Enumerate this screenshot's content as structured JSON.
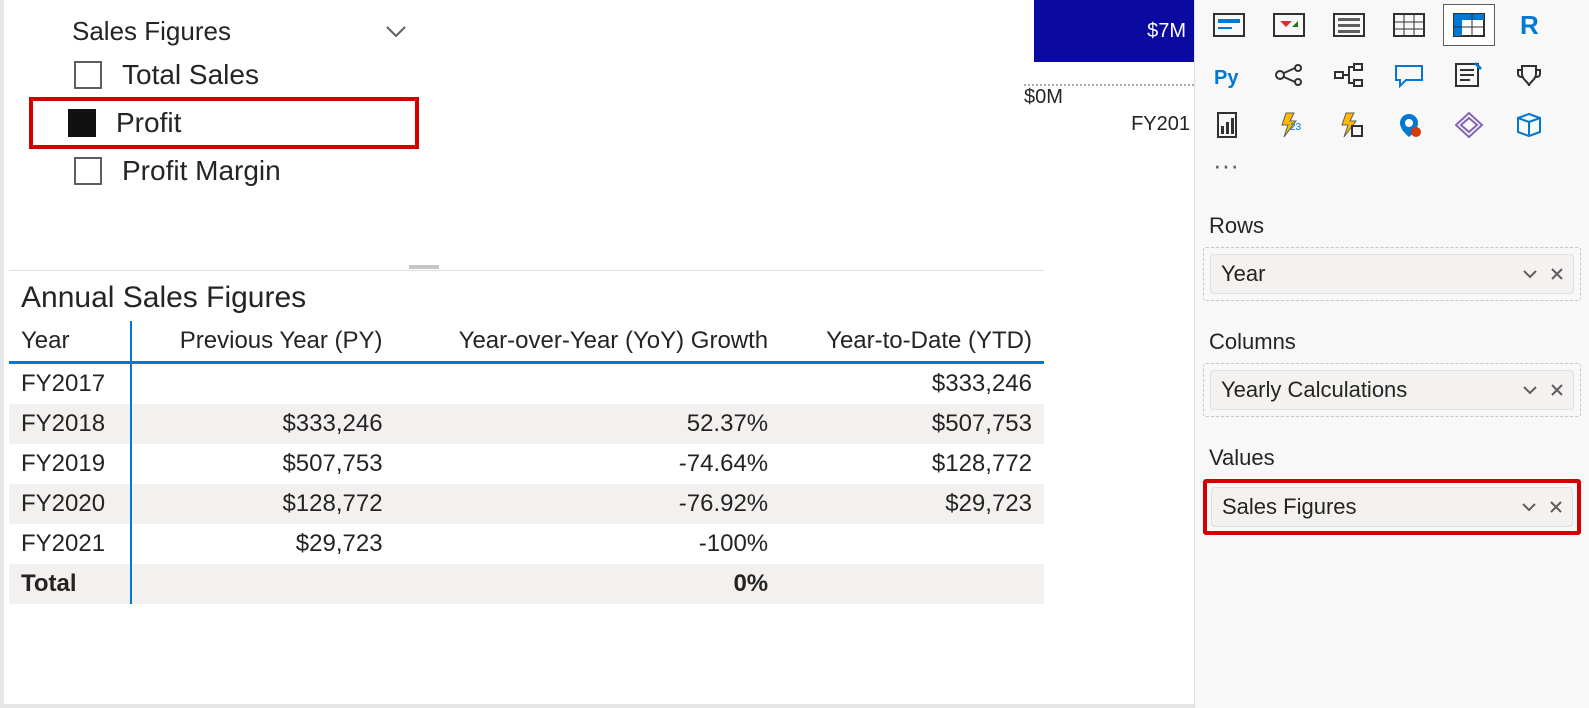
{
  "slicer": {
    "title": "Sales Figures",
    "items": [
      {
        "label": "Total Sales",
        "selected": false
      },
      {
        "label": "Profit",
        "selected": true
      },
      {
        "label": "Profit Margin",
        "selected": false
      }
    ]
  },
  "chart_fragment": {
    "bar_label": "$7M",
    "zero_label": "$0M",
    "x_label": "FY201"
  },
  "table": {
    "title": "Annual Sales Figures",
    "columns": [
      "Year",
      "Previous Year (PY)",
      "Year-over-Year (YoY) Growth",
      "Year-to-Date (YTD)"
    ],
    "rows": [
      {
        "year": "FY2017",
        "py": "",
        "yoy": "",
        "ytd": "$333,246"
      },
      {
        "year": "FY2018",
        "py": "$333,246",
        "yoy": "52.37%",
        "ytd": "$507,753"
      },
      {
        "year": "FY2019",
        "py": "$507,753",
        "yoy": "-74.64%",
        "ytd": "$128,772"
      },
      {
        "year": "FY2020",
        "py": "$128,772",
        "yoy": "-76.92%",
        "ytd": "$29,723"
      },
      {
        "year": "FY2021",
        "py": "$29,723",
        "yoy": "-100%",
        "ytd": ""
      }
    ],
    "total": {
      "year": "Total",
      "py": "",
      "yoy": "0%",
      "ytd": ""
    }
  },
  "panel": {
    "rows_label": "Rows",
    "rows_field": "Year",
    "cols_label": "Columns",
    "cols_field": "Yearly Calculations",
    "vals_label": "Values",
    "vals_field": "Sales Figures",
    "viz_icons": [
      "card-visual",
      "kpi-visual",
      "slicer-visual",
      "table-visual",
      "matrix-visual",
      "r-visual",
      "python-visual",
      "key-influencers-visual",
      "decomposition-tree-visual",
      "qa-visual",
      "narrative-visual",
      "goals-visual",
      "paginated-visual",
      "power-automate-visual",
      "power-apps-visual",
      "arcgis-visual",
      "sparkline-visual",
      "get-more-visual"
    ],
    "more_label": "···"
  }
}
